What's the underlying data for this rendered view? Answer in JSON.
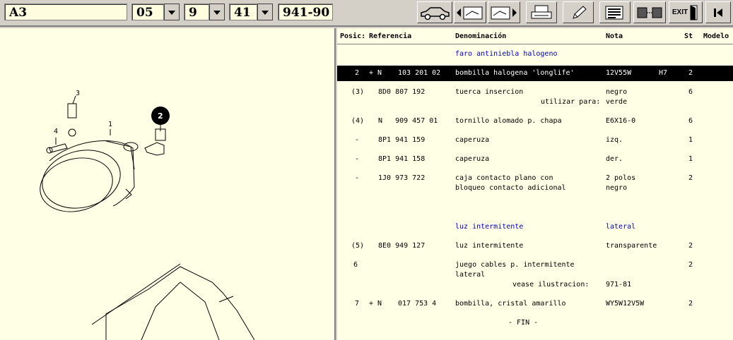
{
  "toolbar": {
    "model": "A3",
    "field1": "05",
    "field2": "9",
    "field3": "41",
    "field4": "941-90",
    "exit_label": "EXIT"
  },
  "drawing": {
    "callouts": [
      "3",
      "4",
      "1",
      "2"
    ]
  },
  "table": {
    "headers": {
      "pos": "Posic:",
      "ref": "Referencia",
      "den": "Denominación",
      "nota": "Nota",
      "st": "St",
      "modelo": "Modelo"
    },
    "section1": "faro antiniebla halogeno",
    "rows": [
      {
        "pos": "2",
        "flag": "+ N",
        "ref": "103 201 02",
        "den": "bombilla halogena 'longlife'",
        "nota": "12V55W",
        "extra": "H7",
        "st": "2"
      },
      {
        "pos": "(3)",
        "flag": "",
        "ref": "8D0 807 192",
        "den": "tuerca insercion",
        "nota": "negro",
        "st": "6",
        "den2": "utilizar para:",
        "nota2": "verde"
      },
      {
        "pos": "(4)",
        "flag": "",
        "ref": "N   909 457 01",
        "den": "tornillo alomado p. chapa",
        "nota": "E6X16-0",
        "st": "6"
      },
      {
        "pos": "-",
        "flag": "",
        "ref": "8P1 941 159",
        "den": "caperuza",
        "nota": "izq.",
        "st": "1"
      },
      {
        "pos": "-",
        "flag": "",
        "ref": "8P1 941 158",
        "den": "caperuza",
        "nota": "der.",
        "st": "1"
      },
      {
        "pos": "-",
        "flag": "",
        "ref": "1J0 973 722",
        "den": "caja contacto plano con",
        "nota": "2 polos",
        "st": "2",
        "den2": "bloqueo contacto adicional",
        "nota2": "negro"
      },
      {
        "pos": "(5)",
        "flag": "",
        "ref": "8E0 949 127",
        "den": "luz intermitente",
        "nota": "transparente",
        "st": "2"
      },
      {
        "pos": "6",
        "flag": "",
        "ref": "",
        "den": "juego cables p. intermitente",
        "nota": "",
        "st": "2",
        "den2": "lateral",
        "den3": "vease ilustracion:",
        "nota3": "971-81"
      },
      {
        "pos": "7",
        "flag": "+ N",
        "ref": "017 753 4",
        "den": "bombilla, cristal amarillo",
        "nota": "WY5W12V5W",
        "st": "2"
      }
    ],
    "section2": "luz intermitente",
    "section2_note": "lateral",
    "end": "- FIN -"
  }
}
